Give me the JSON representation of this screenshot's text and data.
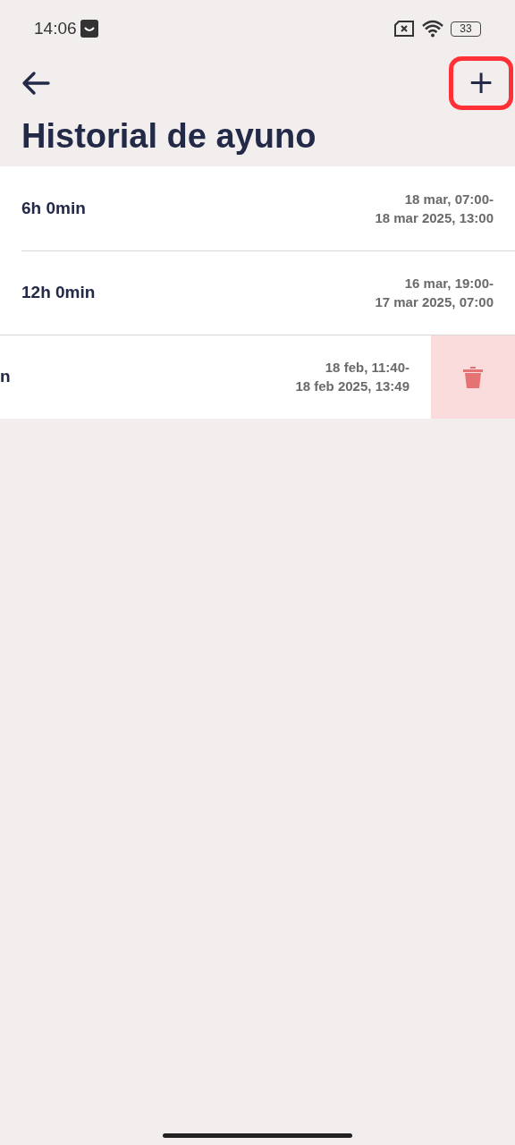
{
  "status_bar": {
    "time": "14:06",
    "battery": "33"
  },
  "title": "Historial de ayuno",
  "add_button": {
    "label": "+",
    "highlighted": true
  },
  "entries": [
    {
      "duration": "6h 0min",
      "start": "18 mar, 07:00-",
      "end": "18 mar 2025, 13:00",
      "swiped": false
    },
    {
      "duration": "12h 0min",
      "start": "16 mar, 19:00-",
      "end": "17 mar 2025, 07:00",
      "swiped": false
    },
    {
      "duration": "n",
      "start": "18 feb, 11:40-",
      "end": "18 feb 2025, 13:49",
      "swiped": true
    }
  ]
}
